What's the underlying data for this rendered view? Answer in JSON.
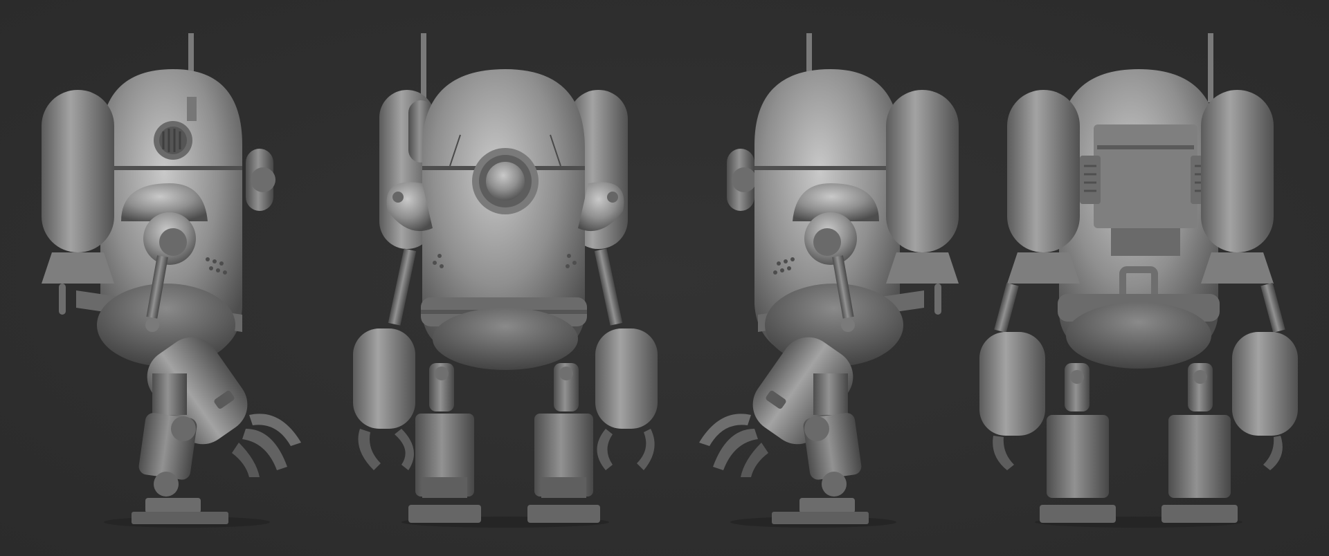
{
  "scene": {
    "background_color": "#2e2e2e",
    "material_base": "#8c8c8c",
    "material_light": "#c4c4c4",
    "material_dark": "#4a4a4a",
    "views": [
      {
        "name": "side-left"
      },
      {
        "name": "front"
      },
      {
        "name": "side-right"
      },
      {
        "name": "back"
      }
    ]
  }
}
